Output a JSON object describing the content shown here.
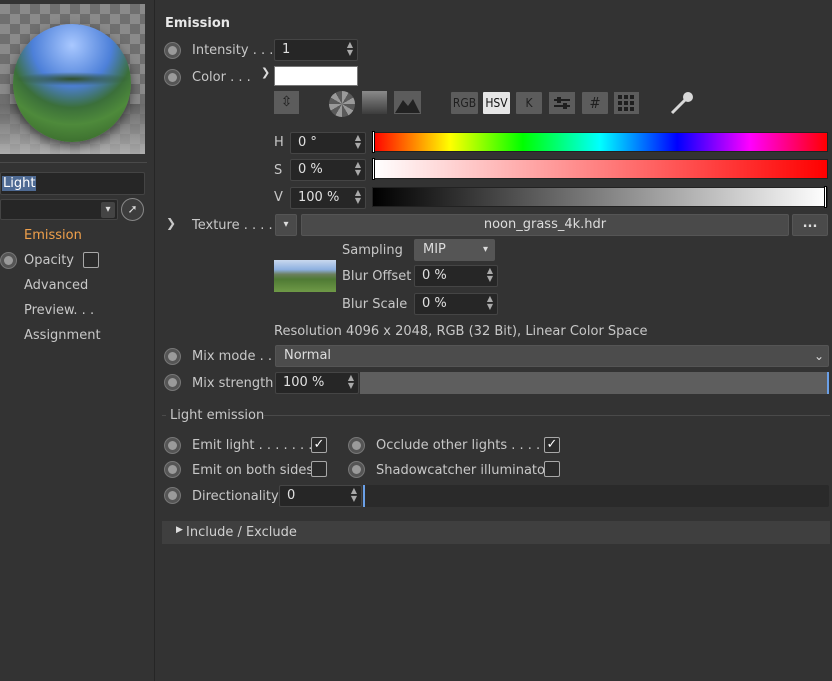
{
  "sidebar": {
    "material_name": "Light",
    "items": [
      {
        "label": "Emission",
        "active": true
      },
      {
        "label": "Opacity"
      },
      {
        "label": "Advanced"
      },
      {
        "label": "Preview. . ."
      },
      {
        "label": "Assignment"
      }
    ]
  },
  "emission": {
    "title": "Emission",
    "intensity_label": "Intensity . . .",
    "intensity_value": "1",
    "color_label": "Color . . .",
    "color_swatch": "#ffffff",
    "modes": [
      "RGB",
      "HSV",
      "K",
      "#"
    ],
    "active_mode": "HSV",
    "h_label": "H",
    "h_value": "0 °",
    "s_label": "S",
    "s_value": "0 %",
    "v_label": "V",
    "v_value": "100 %",
    "texture_label": "Texture . . . .",
    "texture_file": "noon_grass_4k.hdr",
    "texture_more": "...",
    "sampling_label": "Sampling",
    "sampling_value": "MIP",
    "blur_offset_label": "Blur Offset",
    "blur_offset_value": "0 %",
    "blur_scale_label": "Blur Scale",
    "blur_scale_value": "0 %",
    "resolution_text": "Resolution 4096 x 2048, RGB (32 Bit), Linear Color Space",
    "mix_mode_label": "Mix mode . .",
    "mix_mode_value": "Normal",
    "mix_strength_label": "Mix strength",
    "mix_strength_value": "100 %",
    "mix_strength_fraction": 1.0
  },
  "light_emission": {
    "title": "Light emission",
    "emit_light_label": "Emit light . . . . . . .",
    "emit_light_checked": true,
    "occlude_label": "Occlude other lights . . . . .",
    "occlude_checked": true,
    "both_sides_label": "Emit on both sides",
    "both_sides_checked": false,
    "shadowcatcher_label": "Shadowcatcher illuminator",
    "shadowcatcher_checked": false,
    "directionality_label": "Directionality",
    "directionality_value": "0",
    "directionality_fraction": 0.0
  },
  "include_exclude": {
    "label": "Include / Exclude"
  },
  "colors": {
    "accent": "#f0a04b",
    "bg": "#333333"
  }
}
